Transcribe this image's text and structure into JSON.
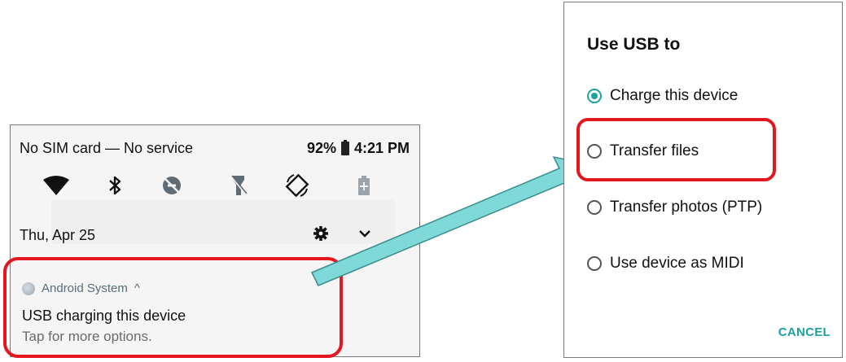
{
  "notification_shade": {
    "carrier": "No SIM card — No service",
    "battery_percent": "92%",
    "time": "4:21 PM",
    "date": "Thu, Apr 25",
    "quick_settings": [
      {
        "icon": "wifi-icon"
      },
      {
        "icon": "bluetooth-icon"
      },
      {
        "icon": "do-not-disturb-icon"
      },
      {
        "icon": "flashlight-off-icon"
      },
      {
        "icon": "auto-rotate-icon"
      },
      {
        "icon": "battery-saver-icon"
      }
    ],
    "notification": {
      "app_name": "Android System",
      "expand_glyph": "^",
      "title": "USB charging this device",
      "subtitle": "Tap for more options."
    }
  },
  "usb_dialog": {
    "title": "Use USB to",
    "options": [
      {
        "label": "Charge this device",
        "selected": true
      },
      {
        "label": "Transfer files",
        "selected": false
      },
      {
        "label": "Transfer photos (PTP)",
        "selected": false
      },
      {
        "label": "Use device as MIDI",
        "selected": false
      }
    ],
    "cancel_label": "CANCEL"
  },
  "colors": {
    "highlight": "#e4161f",
    "accent": "#1aa1a1",
    "arrow": "#7fd9d9"
  }
}
